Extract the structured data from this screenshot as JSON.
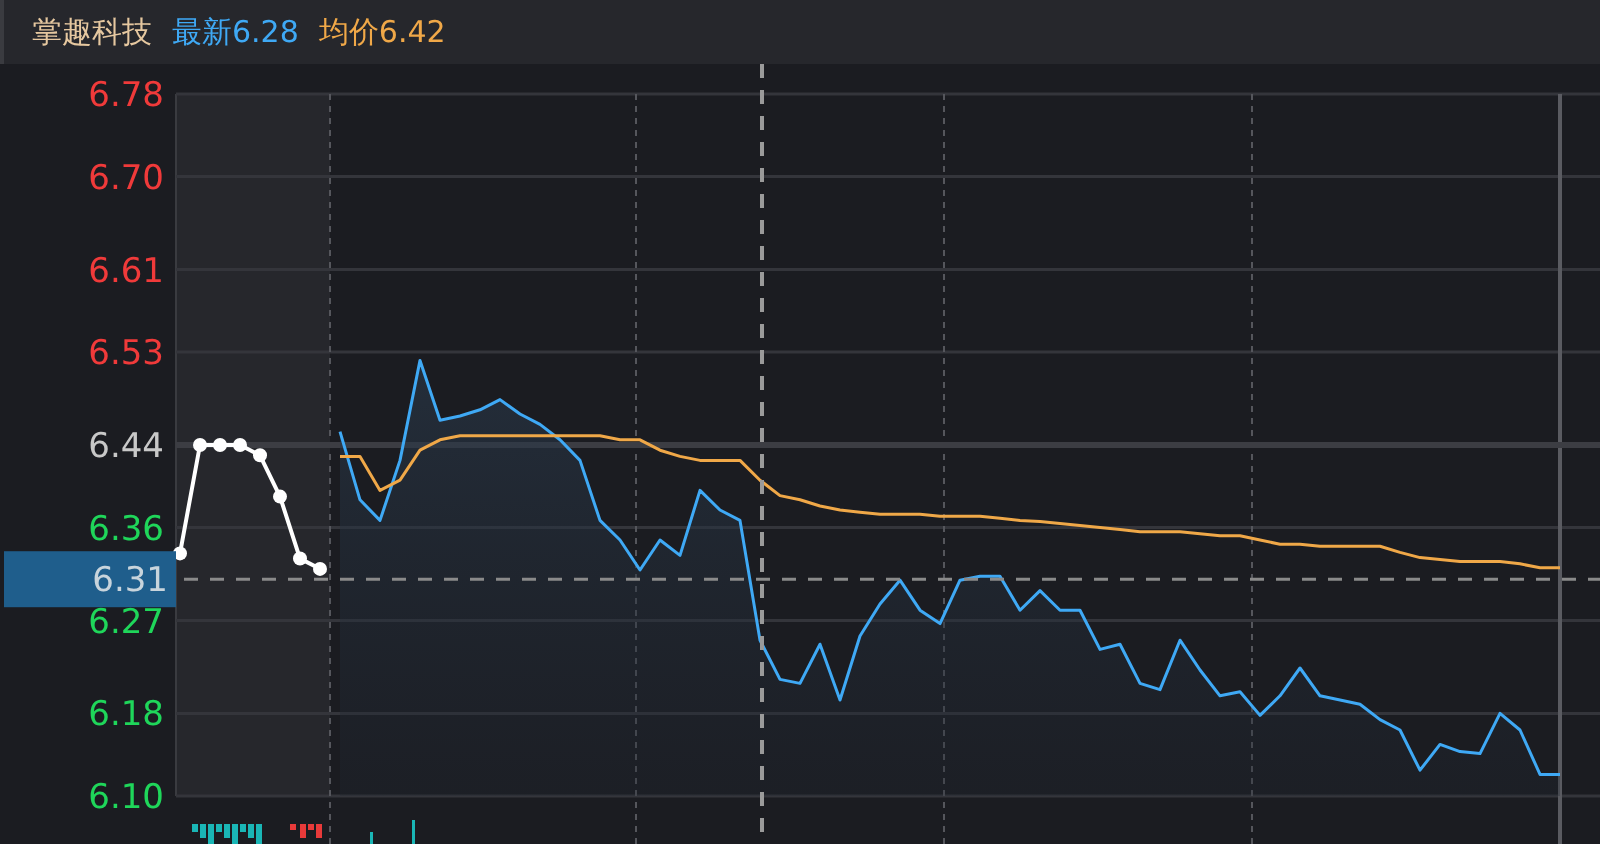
{
  "header": {
    "stock_name": "掌趣科技",
    "latest": "最新6.28",
    "average": "均价6.42"
  },
  "chart_data": {
    "type": "line",
    "grid": true,
    "ylim": [
      6.1,
      6.78
    ],
    "yticks": [
      {
        "value": 6.78,
        "label": "6.78"
      },
      {
        "value": 6.7,
        "label": "6.70"
      },
      {
        "value": 6.61,
        "label": "6.61"
      },
      {
        "value": 6.53,
        "label": "6.53"
      },
      {
        "value": 6.44,
        "label": "6.44"
      },
      {
        "value": 6.36,
        "label": "6.36"
      },
      {
        "value": 6.27,
        "label": "6.27"
      },
      {
        "value": 6.18,
        "label": "6.18"
      },
      {
        "value": 6.1,
        "label": "6.10"
      }
    ],
    "ref_lines": [
      {
        "axis": "y",
        "value": 6.44
      },
      {
        "axis": "y",
        "value": 6.31,
        "label": "6.31"
      }
    ],
    "series": [
      {
        "marker": "circle",
        "color": "#ffffff",
        "values": [
          6.335,
          6.44,
          6.44,
          6.44,
          6.43,
          6.39,
          6.33,
          6.32,
          null,
          null,
          null,
          null,
          null,
          null,
          null,
          null,
          null,
          null,
          null,
          null,
          null,
          null,
          null,
          null,
          null,
          null,
          null,
          null,
          null,
          null,
          null,
          null,
          null,
          null,
          null,
          null,
          null,
          null,
          null,
          null,
          null,
          null,
          null,
          null,
          null,
          null,
          null,
          null,
          null,
          null,
          null,
          null,
          null,
          null,
          null,
          null,
          null,
          null,
          null,
          null,
          null,
          null,
          null,
          null,
          null,
          null,
          null,
          null,
          null,
          null
        ]
      },
      {
        "color": "#3fa9f5",
        "values": [
          null,
          null,
          null,
          null,
          null,
          null,
          null,
          null,
          6.453,
          6.387,
          6.367,
          6.425,
          6.522,
          6.464,
          6.468,
          6.474,
          6.484,
          6.47,
          6.46,
          6.445,
          6.425,
          6.367,
          6.348,
          6.319,
          6.348,
          6.333,
          6.396,
          6.377,
          6.367,
          6.251,
          6.213,
          6.209,
          6.247,
          6.193,
          6.255,
          6.286,
          6.309,
          6.28,
          6.267,
          6.309,
          6.313,
          6.313,
          6.28,
          6.299,
          6.28,
          6.28,
          6.242,
          6.247,
          6.209,
          6.203,
          6.251,
          6.222,
          6.197,
          6.201,
          6.178,
          6.197,
          6.224,
          6.197,
          6.193,
          6.189,
          6.174,
          6.164,
          6.125,
          6.15,
          6.143,
          6.141,
          6.18,
          6.164,
          6.121,
          6.121
        ]
      },
      {
        "color": "#f0a848",
        "values": [
          null,
          null,
          null,
          null,
          null,
          null,
          null,
          null,
          6.429,
          6.429,
          6.396,
          6.406,
          6.435,
          6.445,
          6.449,
          6.449,
          6.449,
          6.449,
          6.449,
          6.449,
          6.449,
          6.449,
          6.445,
          6.445,
          6.435,
          6.429,
          6.425,
          6.425,
          6.425,
          6.406,
          6.391,
          6.387,
          6.381,
          6.377,
          6.375,
          6.373,
          6.373,
          6.373,
          6.371,
          6.371,
          6.371,
          6.369,
          6.367,
          6.366,
          6.364,
          6.362,
          6.36,
          6.358,
          6.356,
          6.356,
          6.356,
          6.354,
          6.352,
          6.352,
          6.348,
          6.344,
          6.344,
          6.342,
          6.342,
          6.342,
          6.342,
          6.336,
          6.331,
          6.329,
          6.327,
          6.327,
          6.327,
          6.325,
          6.321,
          6.321
        ]
      }
    ]
  }
}
